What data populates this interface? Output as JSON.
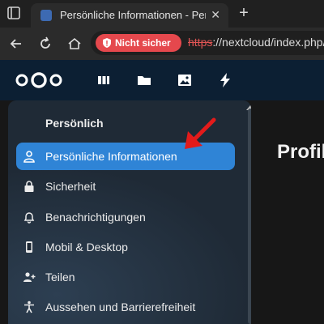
{
  "browser": {
    "tab_title": "Persönliche Informationen - Persö",
    "security_label": "Nicht sicher",
    "url_scheme": "https",
    "url_rest": "://nextcloud/index.php/"
  },
  "header": {
    "apps": [
      "dashboard-icon",
      "files-icon",
      "photos-icon",
      "activity-icon"
    ]
  },
  "sidebar": {
    "section_title": "Persönlich",
    "items": [
      {
        "label": "Persönliche Informationen",
        "icon": "person-icon",
        "active": true
      },
      {
        "label": "Sicherheit",
        "icon": "lock-icon",
        "active": false
      },
      {
        "label": "Benachrichtigungen",
        "icon": "bell-icon",
        "active": false
      },
      {
        "label": "Mobil & Desktop",
        "icon": "phone-icon",
        "active": false
      },
      {
        "label": "Teilen",
        "icon": "share-icon",
        "active": false
      },
      {
        "label": "Aussehen und Barrierefreiheit",
        "icon": "accessibility-icon",
        "active": false
      }
    ]
  },
  "main": {
    "title": "Profil"
  },
  "colors": {
    "accent": "#2f84d6",
    "header": "#0c1f33",
    "warning": "#e5484d"
  }
}
